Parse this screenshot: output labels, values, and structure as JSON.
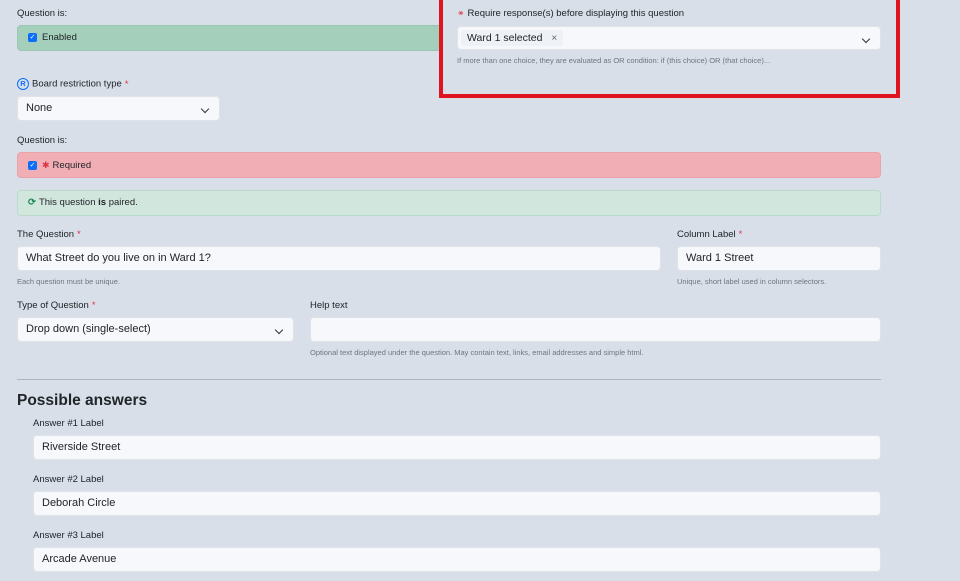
{
  "enabled_section": {
    "label": "Question is:",
    "checkbox_label": "Enabled"
  },
  "require_response": {
    "label": "Require response(s) before displaying this question",
    "selected_tag": "Ward 1 selected",
    "remove_symbol": "×",
    "help": "If more than one choice, they are evaluated as OR condition: if (this choice) OR (that choice)..."
  },
  "board_restriction": {
    "label": "Board restriction type",
    "required_mark": "*",
    "value": "None"
  },
  "required_section": {
    "label": "Question is:",
    "checkbox_label": "Required",
    "asterisk": "✱"
  },
  "paired_notice": {
    "text_before": "This question ",
    "text_bold": "is",
    "text_after": " paired."
  },
  "the_question": {
    "label": "The Question",
    "required_mark": "*",
    "value": "What Street do you live on in Ward 1?",
    "help": "Each question must be unique."
  },
  "column_label": {
    "label": "Column Label",
    "required_mark": "*",
    "value": "Ward 1 Street",
    "help": "Unique, short label used in column selectors."
  },
  "type_of_question": {
    "label": "Type of Question",
    "required_mark": "*",
    "value": "Drop down (single-select)"
  },
  "help_text": {
    "label": "Help text",
    "value": "",
    "help": "Optional text displayed under the question. May contain text, links, email addresses and simple html."
  },
  "possible_answers": {
    "heading": "Possible answers",
    "answers": [
      {
        "label": "Answer #1 Label",
        "value": "Riverside Street"
      },
      {
        "label": "Answer #2 Label",
        "value": "Deborah Circle"
      },
      {
        "label": "Answer #3 Label",
        "value": "Arcade Avenue"
      }
    ]
  },
  "colors": {
    "background": "#d8dfe9",
    "enabled_green": "#a3cfbb",
    "required_red": "#f1aeb5",
    "paired_green": "#d1e7dd",
    "highlight_border": "#e0141e",
    "checkbox_blue": "#0d6efd"
  },
  "icons": {
    "link": "link-icon",
    "registered": "registered-icon",
    "sync": "sync-icon",
    "chevron": "chevron-down-icon",
    "checkbox": "checkbox-checked-icon"
  }
}
